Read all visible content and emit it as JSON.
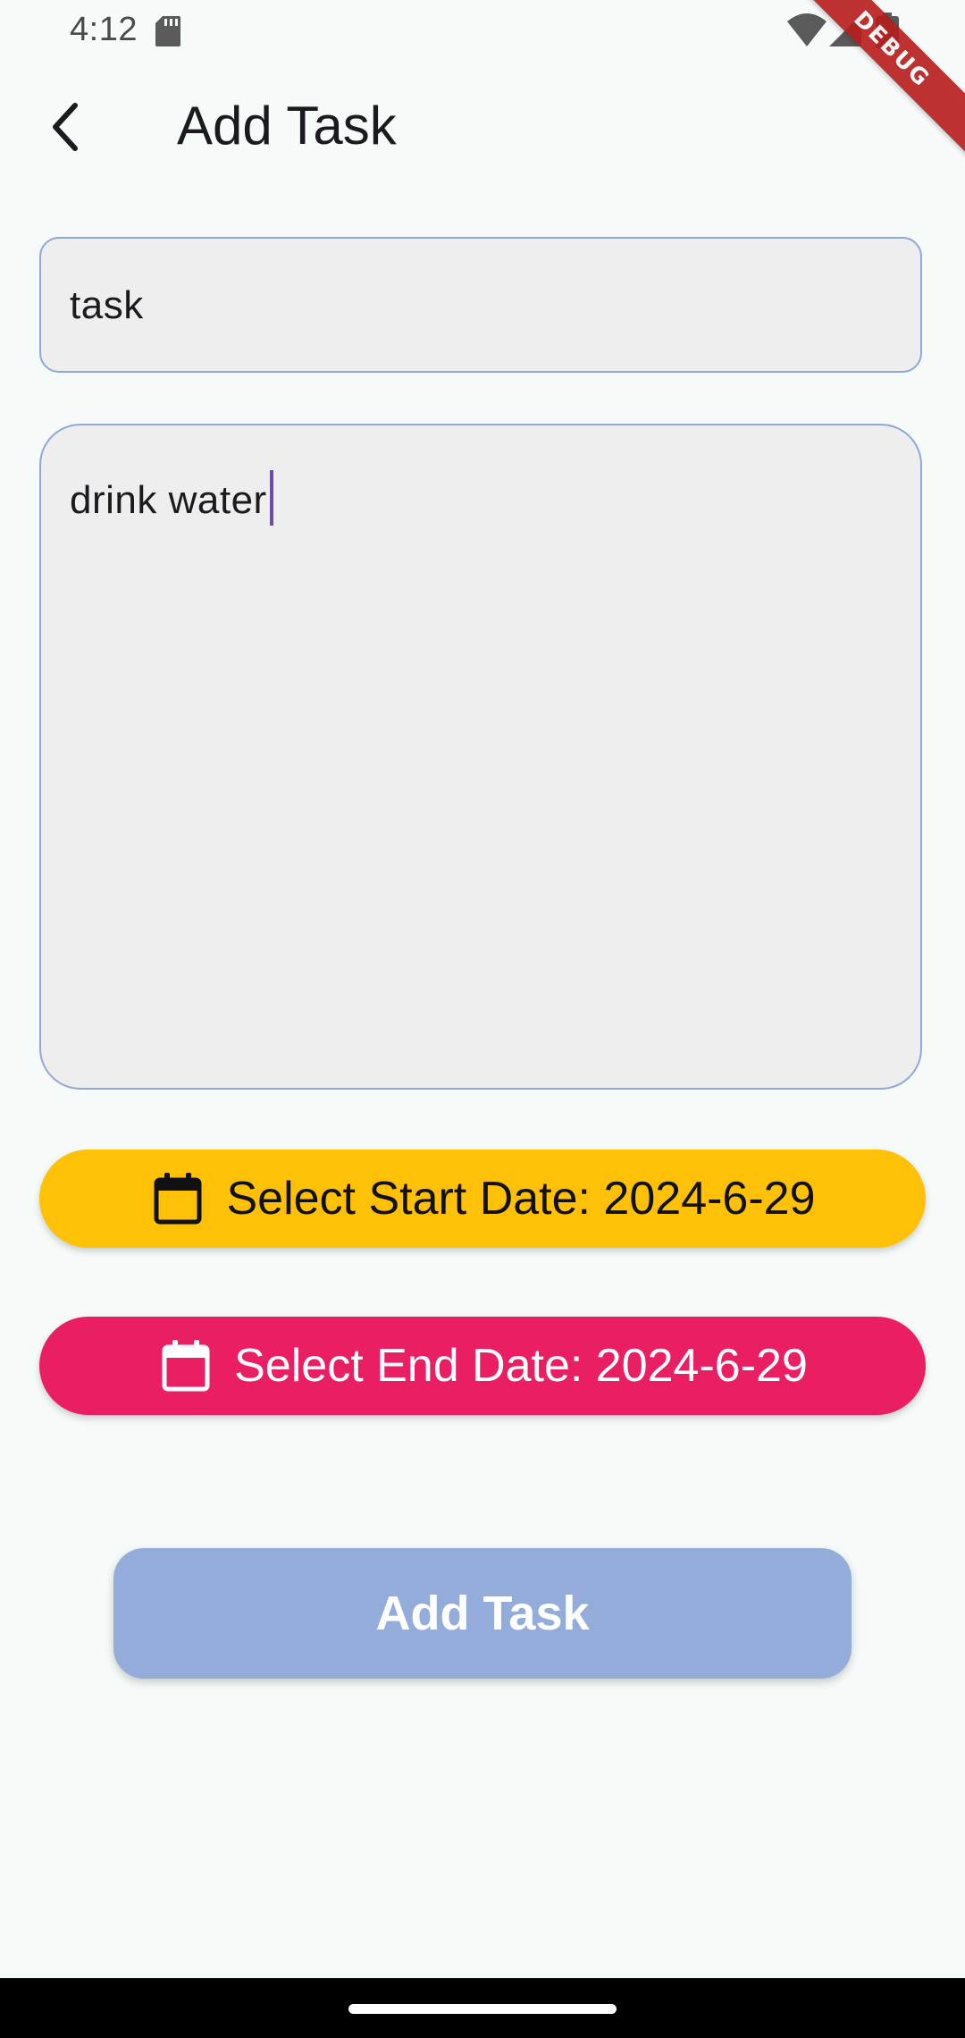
{
  "status_bar": {
    "time": "4:12",
    "icons": [
      "sd-card-icon",
      "wifi-icon",
      "cellular-signal-icon",
      "battery-icon"
    ]
  },
  "debug_banner": {
    "label": "DEBUG",
    "color": "#b71c1c"
  },
  "app_bar": {
    "title": "Add Task",
    "back_icon": "back-arrow-icon"
  },
  "form": {
    "title_field": {
      "value": "task"
    },
    "description_field": {
      "value": "drink water"
    },
    "start_date_button": {
      "label": "Select Start Date: 2024-6-29",
      "icon": "calendar-icon",
      "color": "#fec107"
    },
    "end_date_button": {
      "label": "Select End Date: 2024-6-29",
      "icon": "calendar-icon",
      "color": "#e91e63"
    },
    "submit_button": {
      "label": "Add Task",
      "color": "#93acd9"
    }
  }
}
